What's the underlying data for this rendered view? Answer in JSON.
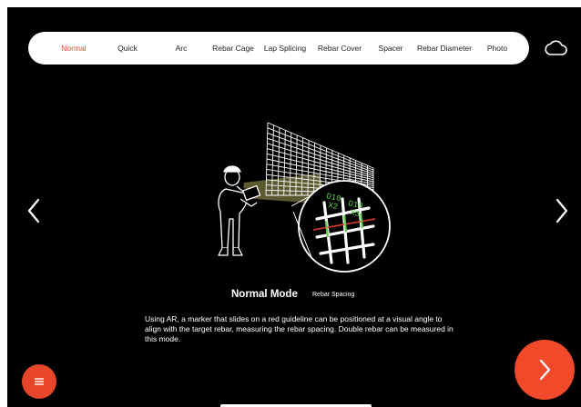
{
  "tabs": [
    {
      "label": "Normal",
      "active": true
    },
    {
      "label": "Quick",
      "active": false
    },
    {
      "label": "Arc",
      "active": false
    },
    {
      "label": "Rebar Cage",
      "active": false
    },
    {
      "label": "Lap Splicing",
      "active": false
    },
    {
      "label": "Rebar Cover",
      "active": false
    },
    {
      "label": "Spacer",
      "active": false
    },
    {
      "label": "Rebar Diameter",
      "active": false
    },
    {
      "label": "Photo",
      "active": false
    }
  ],
  "mode": {
    "title": "Normal Mode",
    "subtitle": "Rebar Spacing",
    "description": "Using AR, a marker that slides on a red guideline can be positioned at a visual angle to align with the target rebar, measuring the rebar spacing. Double rebar can be measured in this mode."
  },
  "illustration": {
    "label_1": "D10",
    "label_1_count": "X2",
    "label_2": "D10",
    "label_2_count": "X3"
  },
  "icons": {
    "cloud": "cloud-icon",
    "prev": "chevron-left-icon",
    "next": "chevron-right-icon",
    "menu": "menu-icon",
    "forward": "arrow-right-icon"
  },
  "colors": {
    "accent": "#e8462a",
    "background": "#000000",
    "tab_text": "#222222",
    "overlay_green": "#5fd14a",
    "guide_red": "#e03a2a"
  }
}
